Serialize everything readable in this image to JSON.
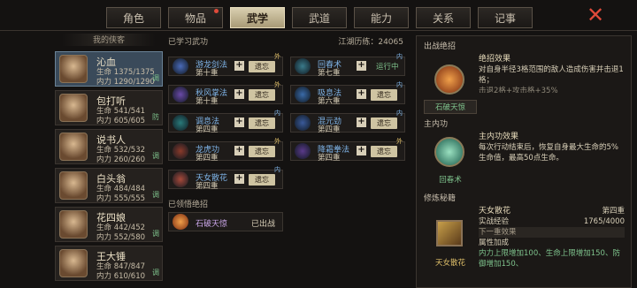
{
  "tabs": [
    {
      "label": "角色",
      "badge": false
    },
    {
      "label": "物品",
      "badge": true
    },
    {
      "label": "武学",
      "badge": false,
      "active": true
    },
    {
      "label": "武道",
      "badge": false
    },
    {
      "label": "能力",
      "badge": false
    },
    {
      "label": "关系",
      "badge": false
    },
    {
      "label": "记事",
      "badge": false
    }
  ],
  "close_icon": "close-x-icon",
  "left": {
    "header": "我的侠客",
    "characters": [
      {
        "name": "沁血",
        "hp": "生命  1375/1375",
        "mp": "内力  1290/1290",
        "tag": "调",
        "selected": true
      },
      {
        "name": "包打听",
        "hp": "生命  541/541",
        "mp": "内力  605/605",
        "tag": "防"
      },
      {
        "name": "说书人",
        "hp": "生命  532/532",
        "mp": "内力  260/260",
        "tag": "调"
      },
      {
        "name": "白头翁",
        "hp": "生命  484/484",
        "mp": "内力  555/555",
        "tag": "调"
      },
      {
        "name": "花四娘",
        "hp": "生命  442/452",
        "mp": "内力  552/580",
        "tag": "调"
      },
      {
        "name": "王大锤",
        "hp": "生命  847/847",
        "mp": "内力  610/610",
        "tag": "调"
      }
    ]
  },
  "middle": {
    "title": "已学习武功",
    "exp": "江湖历练：24065",
    "skills": [
      {
        "name": "游龙剑法",
        "level": "第十重",
        "tag": "外",
        "action": "遗忘",
        "icon": "sword-icon",
        "color": "#4a6ab8"
      },
      {
        "name": "回春术",
        "level": "第七重",
        "tag": "内",
        "action": "",
        "status": "运行中",
        "icon": "heal-icon",
        "color": "#3a7a8a"
      },
      {
        "name": "秋风掌法",
        "level": "第十重",
        "tag": "外",
        "action": "遗忘",
        "icon": "palm-icon",
        "color": "#6a4aa8"
      },
      {
        "name": "吸息法",
        "level": "第六重",
        "tag": "内",
        "action": "遗忘",
        "icon": "breath-icon",
        "color": "#3a6aa8"
      },
      {
        "name": "调息法",
        "level": "第四重",
        "tag": "内",
        "action": "遗忘",
        "icon": "meditate-icon",
        "color": "#2a7a7a"
      },
      {
        "name": "混元劲",
        "level": "第四重",
        "tag": "内",
        "action": "遗忘",
        "icon": "energy-icon",
        "color": "#3a5a9a"
      },
      {
        "name": "龙虎功",
        "level": "第四重",
        "tag": "外",
        "action": "遗忘",
        "icon": "dragon-icon",
        "color": "#8a3a2a"
      },
      {
        "name": "降霜拳法",
        "level": "第四重",
        "tag": "外",
        "action": "遗忘",
        "icon": "frost-icon",
        "color": "#5a3a8a"
      },
      {
        "name": "天女散花",
        "level": "第四重",
        "tag": "内",
        "action": "遗忘",
        "icon": "flower-icon",
        "color": "#a84a3a"
      }
    ],
    "ult_title": "已领悟绝招",
    "ult": {
      "name": "石破天惊",
      "status": "已出战"
    }
  },
  "right": {
    "sec1": "出战绝招",
    "ult_name": "石破天惊",
    "ult_effect_title": "绝招效果",
    "ult_effect": "对自身半径3格范围的敌人造成伤害并击退1格；",
    "ult_effect_more": "击退2格+攻击格+35%",
    "sec2": "主内功",
    "inner_name": "回春术",
    "inner_effect_title": "主内功效果",
    "inner_effect": "每次行动结束后，恢复自身最大生命的5%生命值，最高50点生命。",
    "sec3": "修炼秘籍",
    "book_name": "天女散花",
    "book_level": "第四重",
    "book_exp_label": "实战经验",
    "book_exp": "1765/4000",
    "book_next": "下一重效果",
    "book_attr": "属性加成",
    "book_effect": "内力上限增加100、生命上限增加150、防御增加150、"
  }
}
